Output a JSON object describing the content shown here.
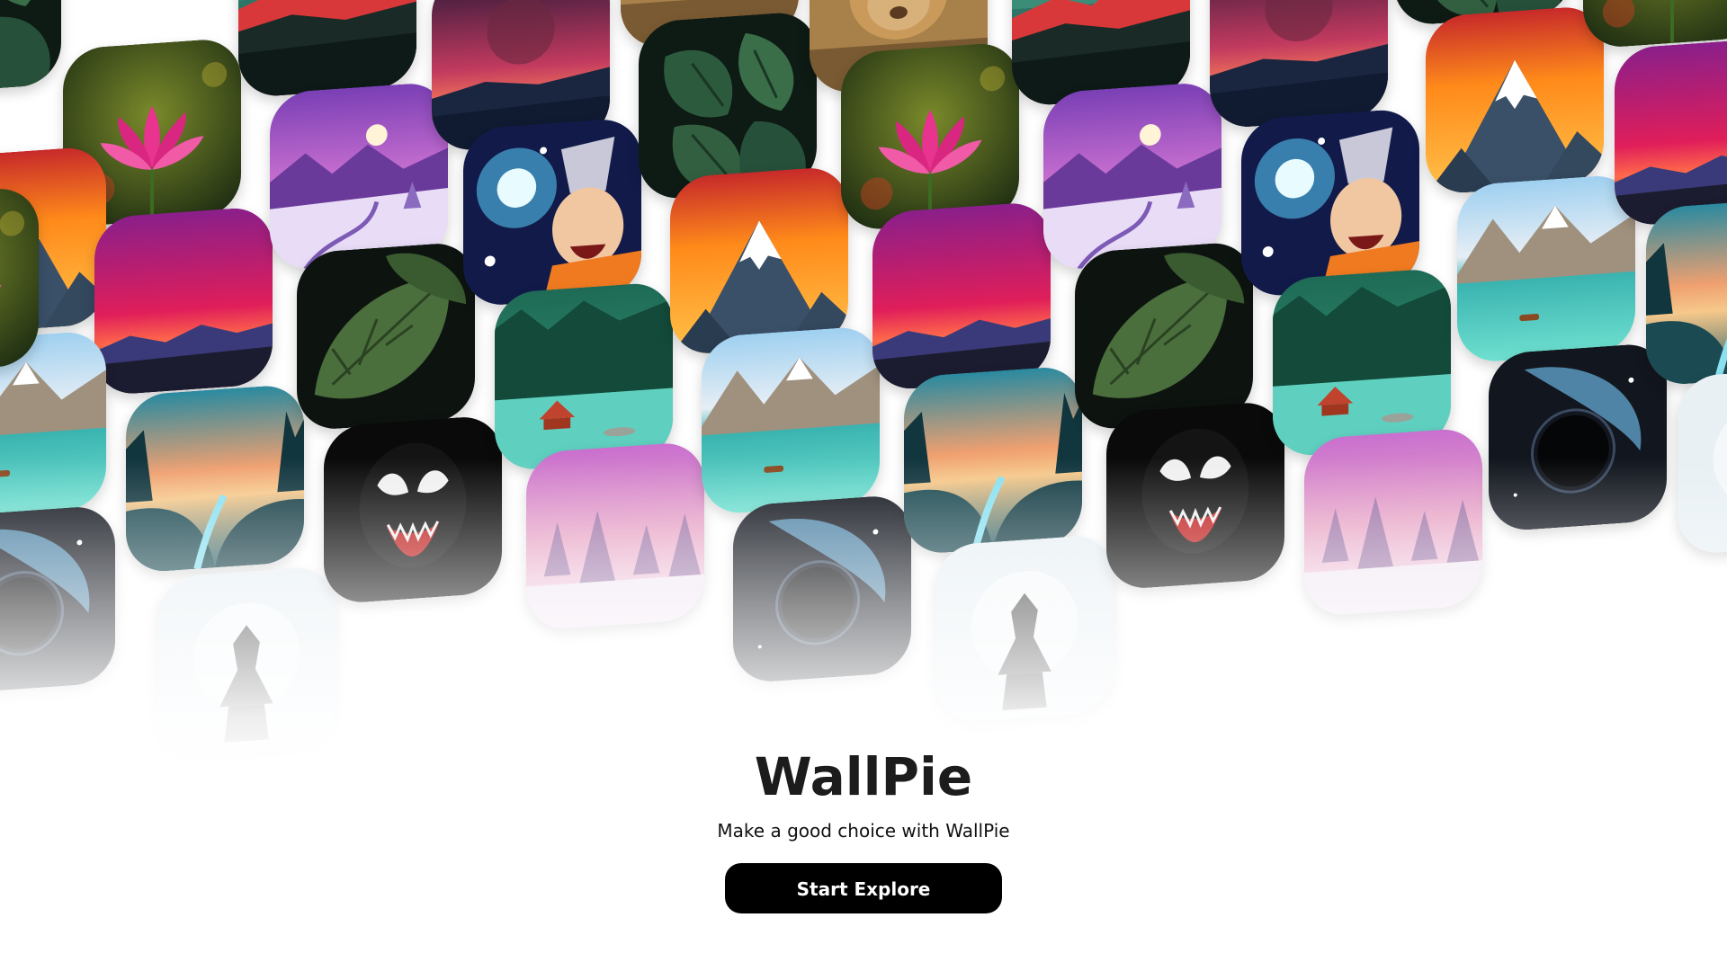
{
  "app": {
    "title": "WallPie",
    "subtitle": "Make a good choice with WallPie",
    "cta_label": "Start Explore",
    "cta_color": "#000000"
  },
  "wallpapers": [
    "lotus",
    "red-mountains",
    "night-sky",
    "monstera",
    "lion-cub",
    "purple-winter",
    "anime-hero",
    "orange-sunset-peak",
    "magenta-sunset",
    "forest-lake",
    "alpine-lake",
    "dark-leaf",
    "venom",
    "pink-forest",
    "teal-dusk-forest",
    "space-planet",
    "silhouette"
  ]
}
